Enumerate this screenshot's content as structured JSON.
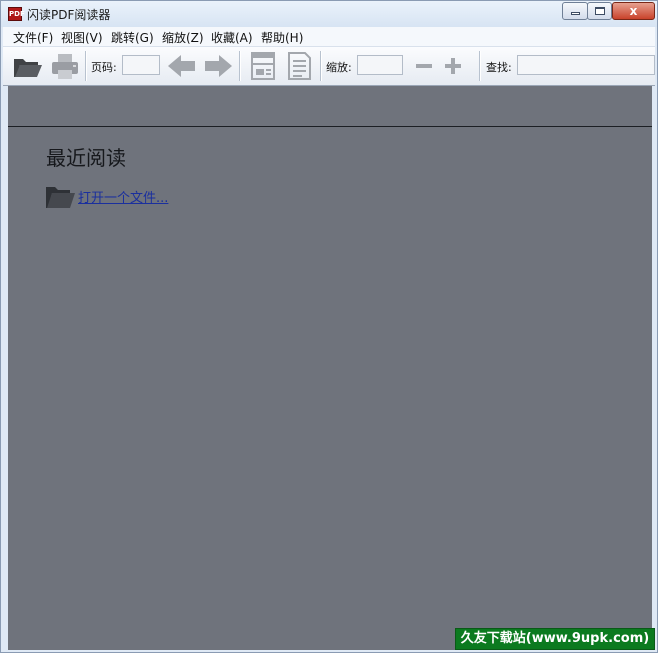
{
  "window": {
    "title": "闪读PDF阅读器",
    "app_icon_text": "PDF",
    "close_glyph": "x"
  },
  "menubar": {
    "items": [
      {
        "label": "文件(F)"
      },
      {
        "label": "视图(V)"
      },
      {
        "label": "跳转(G)"
      },
      {
        "label": "缩放(Z)"
      },
      {
        "label": "收藏(A)"
      },
      {
        "label": "帮助(H)"
      }
    ]
  },
  "toolbar": {
    "page_label": "页码:",
    "page_value": "",
    "zoom_label": "缩放:",
    "zoom_value": "",
    "find_label": "查找:",
    "find_value": "",
    "icons": [
      "open-folder-icon",
      "print-icon",
      "prev-arrow-icon",
      "next-arrow-icon",
      "fit-page-icon",
      "fit-width-icon",
      "zoom-out-icon",
      "zoom-in-icon"
    ]
  },
  "content": {
    "recent_title": "最近阅读",
    "open_link": "打开一个文件..."
  },
  "watermark": {
    "text": "久友下载站(www.9upk.com)"
  },
  "colors": {
    "content_bg": "#6f737c",
    "link": "#1a2f9e",
    "watermark_bg": "#0b7a1f"
  }
}
